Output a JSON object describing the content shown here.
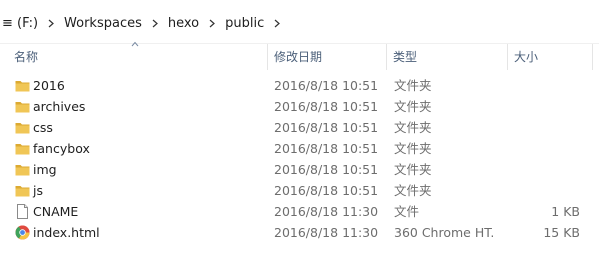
{
  "breadcrumb": {
    "items": [
      "≡ (F:)",
      "Workspaces",
      "hexo",
      "public"
    ]
  },
  "columns": {
    "name": "名称",
    "modified": "修改日期",
    "type": "类型",
    "size": "大小"
  },
  "files": [
    {
      "name": "2016",
      "modified": "2016/8/18 10:51",
      "type": "文件夹",
      "size": "",
      "icon": "folder-icon"
    },
    {
      "name": "archives",
      "modified": "2016/8/18 10:51",
      "type": "文件夹",
      "size": "",
      "icon": "folder-icon"
    },
    {
      "name": "css",
      "modified": "2016/8/18 10:51",
      "type": "文件夹",
      "size": "",
      "icon": "folder-icon"
    },
    {
      "name": "fancybox",
      "modified": "2016/8/18 10:51",
      "type": "文件夹",
      "size": "",
      "icon": "folder-icon"
    },
    {
      "name": "img",
      "modified": "2016/8/18 10:51",
      "type": "文件夹",
      "size": "",
      "icon": "folder-icon"
    },
    {
      "name": "js",
      "modified": "2016/8/18 10:51",
      "type": "文件夹",
      "size": "",
      "icon": "folder-icon"
    },
    {
      "name": "CNAME",
      "modified": "2016/8/18 11:30",
      "type": "文件",
      "size": "1 KB",
      "icon": "file-icon"
    },
    {
      "name": "index.html",
      "modified": "2016/8/18 11:30",
      "type": "360 Chrome HT...",
      "size": "15 KB",
      "icon": "chrome-html-icon"
    }
  ],
  "colors": {
    "header_text": "#4c607a",
    "folder": "#f0c656",
    "folder_dark": "#dcaa32"
  }
}
